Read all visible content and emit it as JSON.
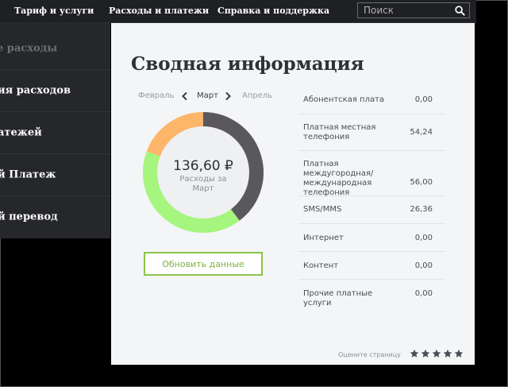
{
  "nav": {
    "items": [
      "Тариф и услуги",
      "Расходы и платежи",
      "Справка и поддержка"
    ],
    "search_placeholder": "Поиск",
    "search_icon": "search-icon"
  },
  "sidebar": {
    "items": [
      {
        "label": "е расходы",
        "active": true
      },
      {
        "label": "ия расходов",
        "active": false
      },
      {
        "label": "атежей",
        "active": false
      },
      {
        "label": "й Платеж",
        "active": false
      },
      {
        "label": "й перевод",
        "active": false
      }
    ]
  },
  "main": {
    "title": "Сводная информация",
    "months": {
      "prev": "Февраль",
      "current": "Март",
      "next": "Апрель"
    },
    "total": "136,60 ₽",
    "total_label": "Расходы за Март",
    "refresh_label": "Обновить данные",
    "donut": {
      "segments": [
        {
          "value": 26.36,
          "color": "#fdb569"
        },
        {
          "value": 56.0,
          "color": "#a6f57e"
        },
        {
          "value": 54.24,
          "color": "#5a585c"
        }
      ]
    },
    "expenses": [
      {
        "name": "Абонентская плата",
        "value": "0,00"
      },
      {
        "name": "Платная местная телефония",
        "value": "54,24"
      },
      {
        "name": "Платная междугородная/ международная телефония",
        "value": "56,00"
      },
      {
        "name": "SMS/MMS",
        "value": "26,36"
      },
      {
        "name": "Интернет",
        "value": "0,00"
      },
      {
        "name": "Контент",
        "value": "0,00"
      },
      {
        "name": "Прочие платные услуги",
        "value": "0,00"
      }
    ],
    "rate_label": "Оцените страницу",
    "rating_stars": 5,
    "star_color": "#4a4d57"
  }
}
